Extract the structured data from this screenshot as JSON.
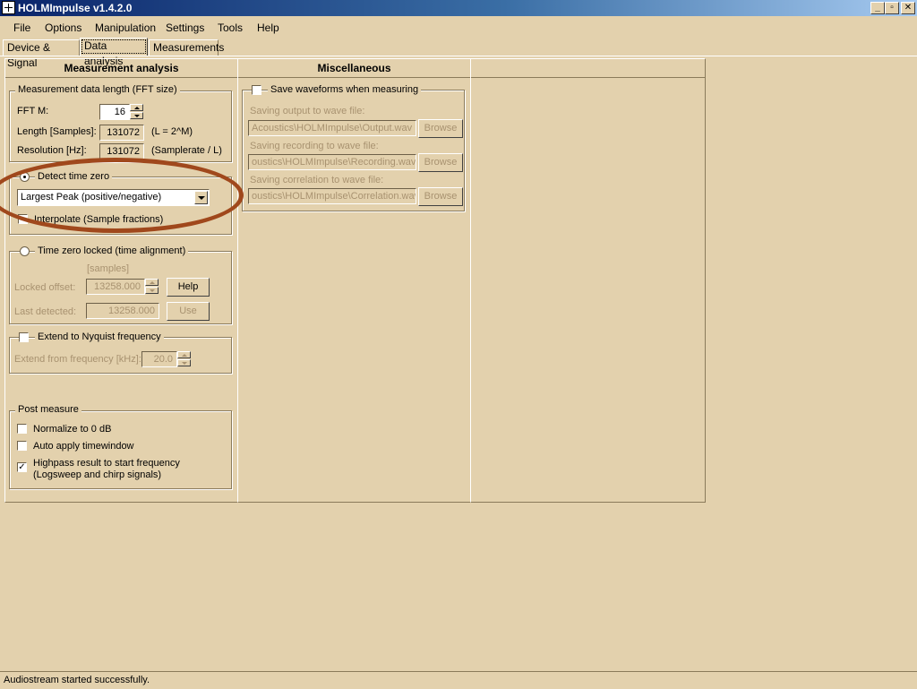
{
  "window": {
    "title": "HOLMImpulse  v1.4.2.0",
    "minimize": "_",
    "maximize": "▫",
    "close": "✕"
  },
  "menu": [
    "File",
    "Options",
    "Manipulation",
    "Settings",
    "Tools",
    "Help"
  ],
  "tabs": [
    "Device & Signal",
    "Data analysis",
    "Measurements"
  ],
  "measurement_analysis": {
    "title": "Measurement analysis",
    "fft_group": {
      "title": "Measurement data length (FFT size)",
      "fft_label": "FFT  M:",
      "fft_value": "16",
      "length_label": "Length [Samples]:",
      "length_value": "131072",
      "length_note": "(L = 2^M)",
      "resolution_label": "Resolution [Hz]:",
      "resolution_value": "131072",
      "resolution_note": "(Samplerate / L)"
    },
    "detect": {
      "label": "Detect time zero",
      "method": "Largest Peak (positive/negative)",
      "interpolate": "Interpolate (Sample fractions)"
    },
    "locked": {
      "label": "Time zero locked (time alignment)",
      "unit": "[samples]",
      "offset_label": "Locked offset:",
      "offset_value": "13258.000",
      "help": "Help",
      "last_label": "Last detected:",
      "last_value": "13258.000",
      "use": "Use"
    },
    "nyquist": {
      "label": "Extend to Nyquist frequency",
      "from_label": "Extend from frequency [kHz]:",
      "from_value": "20.0"
    },
    "post": {
      "title": "Post measure",
      "normalize": "Normalize to 0 dB",
      "autowindow": "Auto apply timewindow",
      "highpass_1": "Highpass result to start frequency",
      "highpass_2": "(Logsweep and chirp signals)"
    }
  },
  "misc": {
    "title": "Miscellaneous",
    "save_label": "Save waveforms when measuring",
    "output_label": "Saving output to wave file:",
    "output_path": "Acoustics\\HOLMImpulse\\Output.wav",
    "recording_label": "Saving recording to wave file:",
    "recording_path": "oustics\\HOLMImpulse\\Recording.wav",
    "correlation_label": "Saving correlation to wave file:",
    "correlation_path": "oustics\\HOLMImpulse\\Correlation.wav",
    "browse": "Browse"
  },
  "status": "Audiostream started successfully."
}
